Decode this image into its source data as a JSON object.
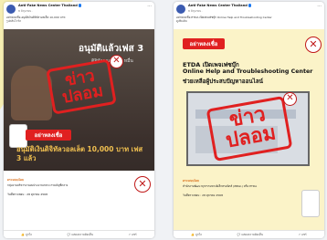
{
  "left_post": {
    "page_name": "Anti-Fake News Center Thailand",
    "meta": "8 มิถุนายน ·",
    "caption_line1": "อย่าหลงเชื่อ อนุมัติเงินดิจิทัลวอลเล็ต 10,000 บาท",
    "caption_line2": "รูปคลิปไวรัล",
    "image_title": "อนุมัติแล้วเฟส 3",
    "image_subtitle": "ดิจิทัลวอลเล็ต 1 หมื่น",
    "stamp_text": "ข่าวปลอม",
    "banner_text": "อย่าหลงเชื่อ",
    "headline": "อนุมัติเงินดิจิทัลวอลเล็ต 10,000 บาท เฟส 3 แล้ว",
    "check_label": "ตรวจสอบโดย",
    "check_body": "กลุ่มงานบริหารงานงบประมาณกลาง กรมบัญชีกลาง",
    "date_label": "วันที่ตรวจสอบ : 28 ตุลาคม 2568",
    "actions": [
      "ถูกใจ",
      "แสดงความคิดเห็น",
      "แชร์"
    ]
  },
  "right_post": {
    "page_name": "Anti-Fake News Center Thailand",
    "meta": "8 มิถุนายน ·",
    "caption_line1": "อย่าหลงเชื่อ ETDA เปิดเพจเฟซบุ๊ก Online Help and Troubleshooting Center",
    "caption_line2": "ดูเพิ่มเติม",
    "banner_text": "อย่าหลงเชื่อ",
    "headline_line1": "ETDA เปิดเพจเฟซบุ๊ก",
    "headline_line2": "Online Help and Troubleshooting Center",
    "headline_line3": "ช่วยเหลือผู้ประสบปัญหาออนไลน์",
    "stamp_text": "ข่าวปลอม",
    "check_label": "ตรวจสอบโดย",
    "check_body": "สำนักงานพัฒนาธุรกรรมทางอิเล็กทรอนิกส์ (สพธอ.) หรือ ETDA",
    "date_label": "วันที่ตรวจสอบ : 28 ตุลาคม 2568",
    "actions": [
      "ถูกใจ",
      "แสดงความคิดเห็น",
      "แชร์"
    ]
  },
  "colors": {
    "fake_red": "#e02020",
    "accent_yellow": "#f6eeb2",
    "brand_blue": "#1877f2"
  }
}
